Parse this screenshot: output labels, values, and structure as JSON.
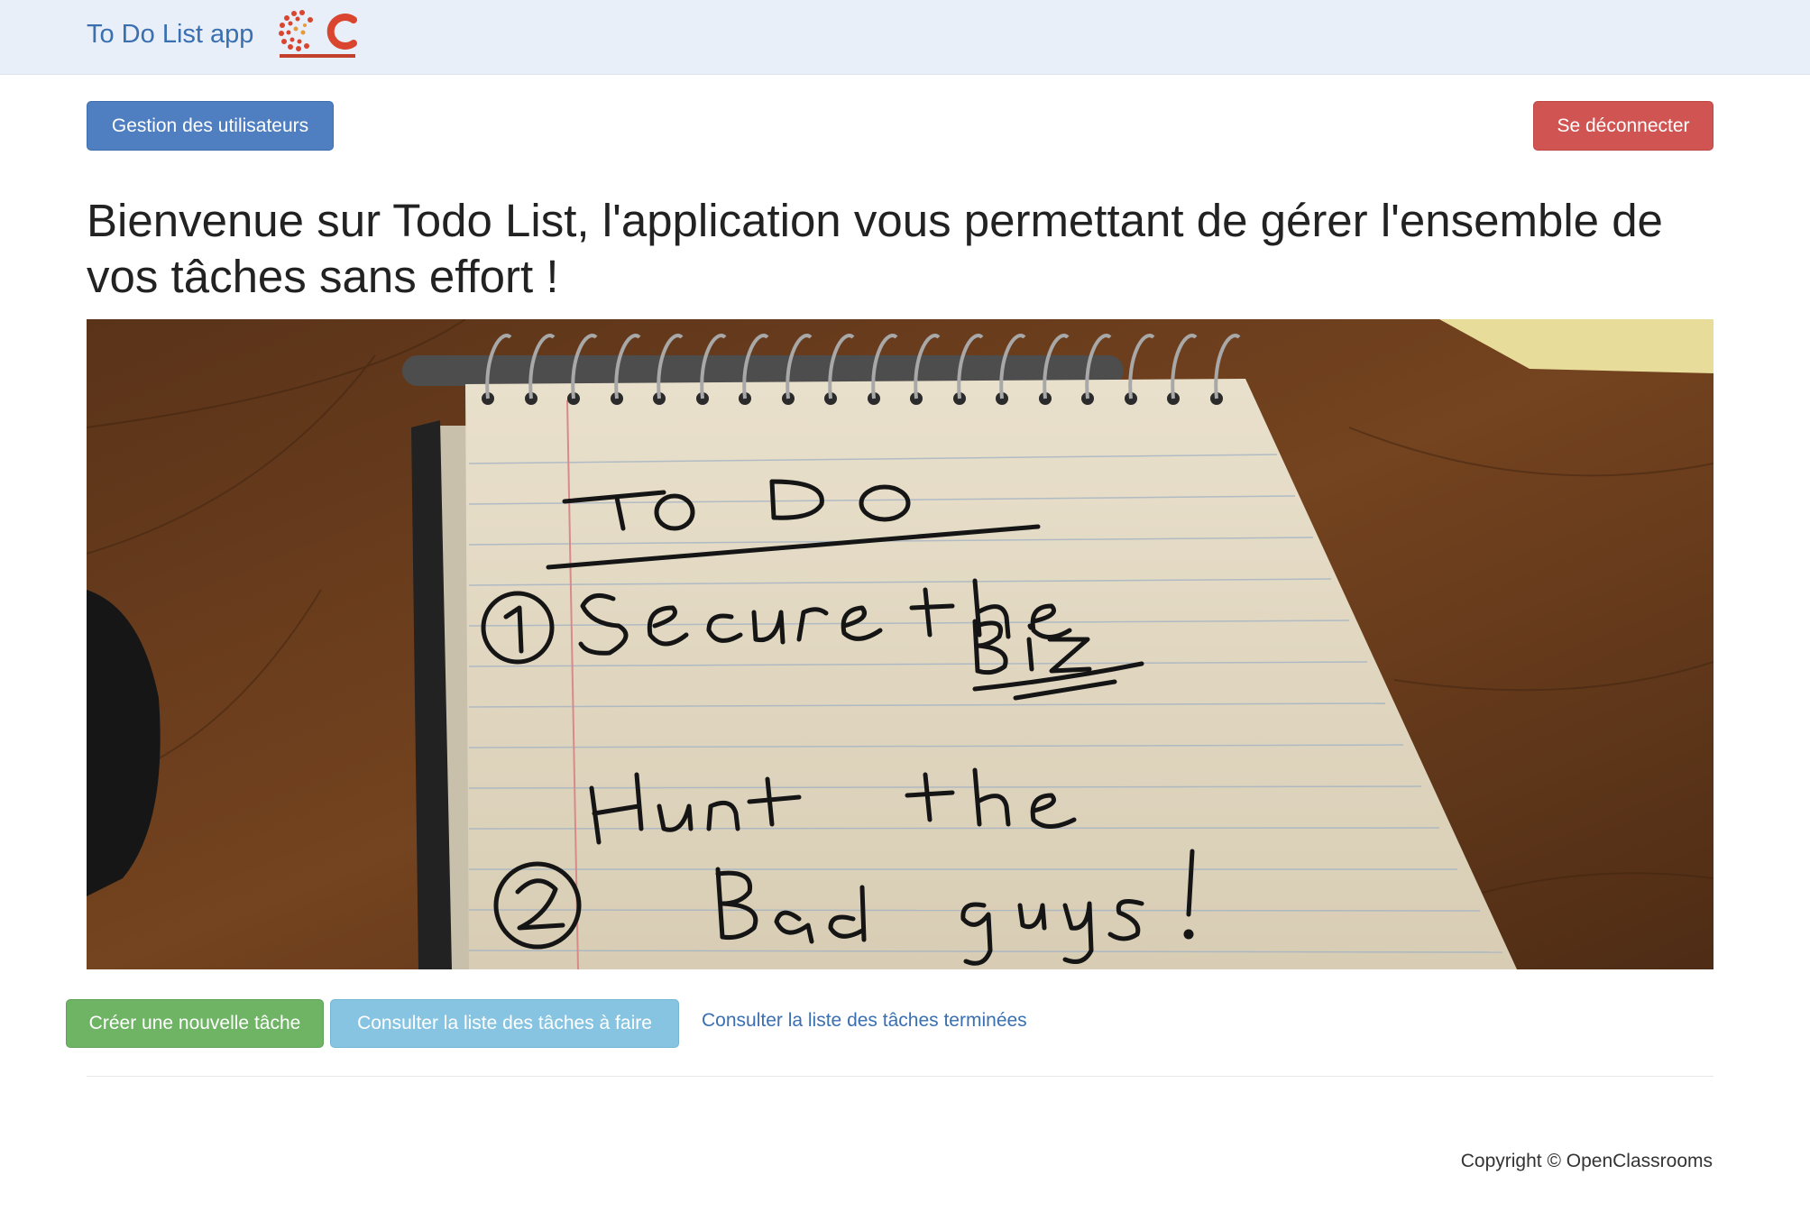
{
  "navbar": {
    "brand": "To Do List app",
    "logo_icon": "openclassrooms-logo-icon"
  },
  "toolbar": {
    "users_button": "Gestion des utilisateurs",
    "logout_button": "Se déconnecter"
  },
  "main": {
    "title": "Bienvenue sur Todo List, l'application vous permettant de gérer l'ensemble de vos tâches sans effort !",
    "hero_icon": "todo-notepad-photo"
  },
  "actions": {
    "create_button": "Créer une nouvelle tâche",
    "todo_list_button": "Consulter la liste des tâches à faire",
    "done_list_link": "Consulter la liste des tâches terminées"
  },
  "footer": {
    "copyright": "Copyright © OpenClassrooms"
  },
  "colors": {
    "navbar_bg": "#e8eff9",
    "primary": "#4f7fc1",
    "danger": "#d05452",
    "success": "#6fb365",
    "info": "#86c4e1",
    "link": "#3a6fb0"
  }
}
